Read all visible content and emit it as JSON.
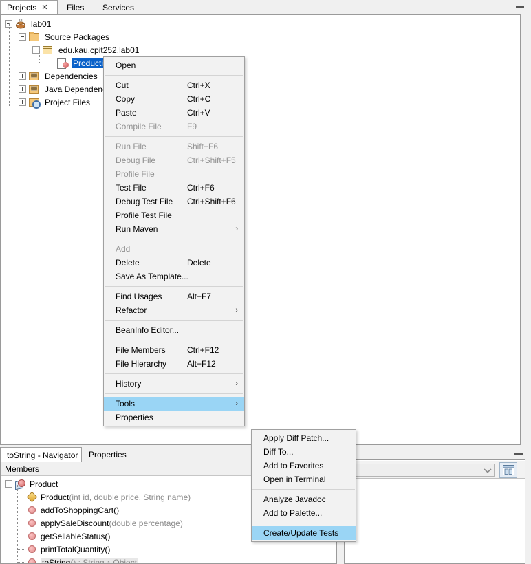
{
  "window": {
    "minimize_icon": "minimize-icon"
  },
  "top_tabs": [
    {
      "label": "Projects",
      "active": true,
      "closable": true,
      "close_icon": "close-icon"
    },
    {
      "label": "Files",
      "active": false,
      "closable": false
    },
    {
      "label": "Services",
      "active": false,
      "closable": false
    }
  ],
  "project_tree": [
    {
      "label": "lab01",
      "icon": "java-project-icon",
      "depth": 0,
      "expander": "minus",
      "selected": false
    },
    {
      "label": "Source Packages",
      "icon": "source-packages-icon",
      "depth": 1,
      "expander": "minus",
      "selected": false
    },
    {
      "label": "edu.kau.cpit252.lab01",
      "icon": "package-icon",
      "depth": 2,
      "expander": "minus",
      "selected": false
    },
    {
      "label": "Production.java",
      "icon": "java-file-icon",
      "depth": 3,
      "expander": "none",
      "selected": true
    },
    {
      "label": "Dependencies",
      "icon": "libraries-icon",
      "depth": 1,
      "expander": "plus",
      "selected": false
    },
    {
      "label": "Java Dependencies",
      "icon": "libraries-icon",
      "depth": 1,
      "expander": "plus",
      "selected": false
    },
    {
      "label": "Project Files",
      "icon": "project-files-icon",
      "depth": 1,
      "expander": "plus",
      "selected": false
    }
  ],
  "context_menu": {
    "name": "file-context-menu",
    "items": [
      {
        "type": "item",
        "label": "Open",
        "accel": "",
        "disabled": false,
        "submenu": false,
        "selected": false
      },
      {
        "type": "separator"
      },
      {
        "type": "item",
        "label": "Cut",
        "accel": "Ctrl+X",
        "disabled": false,
        "submenu": false,
        "selected": false
      },
      {
        "type": "item",
        "label": "Copy",
        "accel": "Ctrl+C",
        "disabled": false,
        "submenu": false,
        "selected": false
      },
      {
        "type": "item",
        "label": "Paste",
        "accel": "Ctrl+V",
        "disabled": false,
        "submenu": false,
        "selected": false
      },
      {
        "type": "item",
        "label": "Compile File",
        "accel": "F9",
        "disabled": true,
        "submenu": false,
        "selected": false
      },
      {
        "type": "separator"
      },
      {
        "type": "item",
        "label": "Run File",
        "accel": "Shift+F6",
        "disabled": true,
        "submenu": false,
        "selected": false
      },
      {
        "type": "item",
        "label": "Debug File",
        "accel": "Ctrl+Shift+F5",
        "disabled": true,
        "submenu": false,
        "selected": false
      },
      {
        "type": "item",
        "label": "Profile File",
        "accel": "",
        "disabled": true,
        "submenu": false,
        "selected": false
      },
      {
        "type": "item",
        "label": "Test File",
        "accel": "Ctrl+F6",
        "disabled": false,
        "submenu": false,
        "selected": false
      },
      {
        "type": "item",
        "label": "Debug Test File",
        "accel": "Ctrl+Shift+F6",
        "disabled": false,
        "submenu": false,
        "selected": false
      },
      {
        "type": "item",
        "label": "Profile Test File",
        "accel": "",
        "disabled": false,
        "submenu": false,
        "selected": false
      },
      {
        "type": "item",
        "label": "Run Maven",
        "accel": "",
        "disabled": false,
        "submenu": true,
        "selected": false
      },
      {
        "type": "separator"
      },
      {
        "type": "item",
        "label": "Add",
        "accel": "",
        "disabled": true,
        "submenu": false,
        "selected": false
      },
      {
        "type": "item",
        "label": "Delete",
        "accel": "Delete",
        "disabled": false,
        "submenu": false,
        "selected": false
      },
      {
        "type": "item",
        "label": "Save As Template...",
        "accel": "",
        "disabled": false,
        "submenu": false,
        "selected": false
      },
      {
        "type": "separator"
      },
      {
        "type": "item",
        "label": "Find Usages",
        "accel": "Alt+F7",
        "disabled": false,
        "submenu": false,
        "selected": false
      },
      {
        "type": "item",
        "label": "Refactor",
        "accel": "",
        "disabled": false,
        "submenu": true,
        "selected": false
      },
      {
        "type": "separator"
      },
      {
        "type": "item",
        "label": "BeanInfo Editor...",
        "accel": "",
        "disabled": false,
        "submenu": false,
        "selected": false
      },
      {
        "type": "separator"
      },
      {
        "type": "item",
        "label": "File Members",
        "accel": "Ctrl+F12",
        "disabled": false,
        "submenu": false,
        "selected": false
      },
      {
        "type": "item",
        "label": "File Hierarchy",
        "accel": "Alt+F12",
        "disabled": false,
        "submenu": false,
        "selected": false
      },
      {
        "type": "separator"
      },
      {
        "type": "item",
        "label": "History",
        "accel": "",
        "disabled": false,
        "submenu": true,
        "selected": false
      },
      {
        "type": "separator"
      },
      {
        "type": "item",
        "label": "Tools",
        "accel": "",
        "disabled": false,
        "submenu": true,
        "selected": true
      },
      {
        "type": "item",
        "label": "Properties",
        "accel": "",
        "disabled": false,
        "submenu": false,
        "selected": false
      }
    ]
  },
  "tools_submenu": {
    "name": "tools-submenu",
    "items": [
      {
        "type": "item",
        "label": "Apply Diff Patch...",
        "disabled": false,
        "selected": false
      },
      {
        "type": "item",
        "label": "Diff To...",
        "disabled": false,
        "selected": false
      },
      {
        "type": "item",
        "label": "Add to Favorites",
        "disabled": false,
        "selected": false
      },
      {
        "type": "item",
        "label": "Open in Terminal",
        "disabled": false,
        "selected": false
      },
      {
        "type": "separator"
      },
      {
        "type": "item",
        "label": "Analyze Javadoc",
        "disabled": false,
        "selected": false
      },
      {
        "type": "item",
        "label": "Add to Palette...",
        "disabled": false,
        "selected": false
      },
      {
        "type": "separator"
      },
      {
        "type": "item",
        "label": "Create/Update Tests",
        "disabled": false,
        "selected": true
      }
    ]
  },
  "navigator": {
    "tabs": [
      {
        "label": "toString - Navigator",
        "active": true
      },
      {
        "label": "Properties",
        "active": false
      }
    ],
    "column_header": "Members",
    "members": [
      {
        "icon": "class-icon",
        "depth": 0,
        "expander": "minus",
        "name": "Product",
        "signature": "",
        "return_type": "",
        "highlighted": false
      },
      {
        "icon": "constructor-icon",
        "depth": 1,
        "expander": "none",
        "name": "Product",
        "signature": "(int id, double price, String name)",
        "return_type": "",
        "highlighted": false
      },
      {
        "icon": "method-icon",
        "depth": 1,
        "expander": "none",
        "name": "addToShoppingCart",
        "signature": "()",
        "return_type": "",
        "highlighted": false
      },
      {
        "icon": "method-icon",
        "depth": 1,
        "expander": "none",
        "name": "applySaleDiscount",
        "signature": "(double percentage)",
        "return_type": "",
        "highlighted": false
      },
      {
        "icon": "method-icon",
        "depth": 1,
        "expander": "none",
        "name": "getSellableStatus",
        "signature": "()",
        "return_type": "",
        "highlighted": false
      },
      {
        "icon": "method-icon",
        "depth": 1,
        "expander": "none",
        "name": "printTotalQuantity",
        "signature": "()",
        "return_type": "",
        "highlighted": false
      },
      {
        "icon": "method-icon",
        "depth": 1,
        "expander": "none",
        "name": "toString",
        "signature": "() : String ↑ Object",
        "return_type": "",
        "highlighted": true
      }
    ]
  },
  "properties_panel": {
    "minimize_icon": "minimize-icon",
    "combo_value": "",
    "combo_arrow_icon": "chevron-down-icon",
    "window_button_icon": "window-layout-icon"
  },
  "colors": {
    "selection_blue": "#0a61c9",
    "menu_highlight": "#9ad5f5",
    "menu_bg": "#f2f2f2",
    "disabled_text": "#919191",
    "panel_bg": "#f0f0f0"
  }
}
